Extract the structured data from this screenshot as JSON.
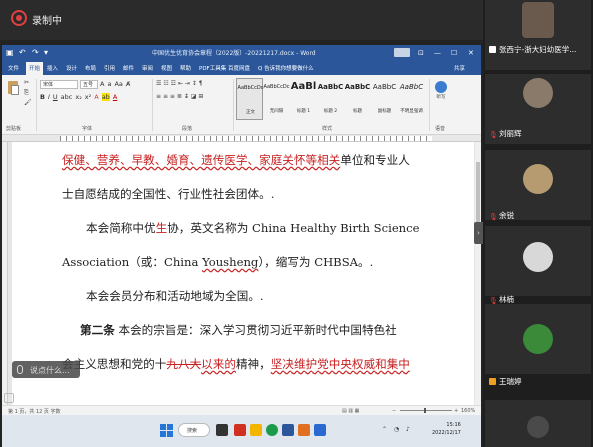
{
  "meeting": {
    "recording_label": "录制中",
    "mic_label": "说点什么..."
  },
  "word": {
    "title": "中国优生优育协会章程（2022版）-20221217.docx - Word",
    "menu": [
      "文件",
      "开始",
      "插入",
      "设计",
      "布局",
      "引用",
      "邮件",
      "审阅",
      "视图",
      "帮助",
      "PDF工具集",
      "百度网盘",
      "Q 告诉我你想要做什么"
    ],
    "menu_right": "共享",
    "font_name": "宋体",
    "font_size": "五号",
    "styles": [
      {
        "sample": "AaBbCcDc",
        "name": "正文"
      },
      {
        "sample": "AaBbCcDc",
        "name": "无间隔"
      },
      {
        "sample": "AaBl",
        "name": "标题 1"
      },
      {
        "sample": "AaBbC",
        "name": "标题 2"
      },
      {
        "sample": "AaBbC",
        "name": "标题"
      },
      {
        "sample": "AaBbC",
        "name": "副标题"
      },
      {
        "sample": "AaBbC",
        "name": "不明显强调"
      }
    ],
    "dictate_label": "听写",
    "ribbon_groups": [
      "剪贴板",
      "字体",
      "段落",
      "样式",
      "语音"
    ],
    "doc_lines": {
      "l1_red": "保健、营养、早教、婚育、遗传医学、家庭关怀等相关",
      "l1_black": "单位和专业人",
      "l2": "士自愿结成的全国性、行业性社会团体。.",
      "l3_pre": "本会简称中优",
      "l3_red": "生",
      "l3_post": "协，英文名称为 China Healthy Birth Science",
      "l4_pre": "Association（或：China ",
      "l4_red": "Yousheng",
      "l4_post": "），缩写为 CHBSA。.",
      "l5": "本会会员分布和活动地域为全国。.",
      "l6_bold": "第二条",
      "l6_rest": " 本会的宗旨是：深入学习贯彻习近平新时代中国特色社",
      "l7_pre": "会主义思想和党的十",
      "l7_red1": "九八大",
      "l7_red2": "以来的",
      "l7_mid": "精神，",
      "l7_red3": "坚决维护党中央权威和集中"
    },
    "status_left": "第 1 页，共 12 页    字数",
    "zoom_label": "160%"
  },
  "taskbar": {
    "search_label": "搜索",
    "time": "15:16",
    "date": "2022/12/17"
  },
  "participants": [
    {
      "name": "张西宁-浙大妇幼医学...",
      "muted": false
    },
    {
      "name": "刘丽辉",
      "muted": true
    },
    {
      "name": "余锐",
      "muted": true
    },
    {
      "name": "林楠",
      "muted": true
    },
    {
      "name": "王瑞婷",
      "muted": true
    }
  ],
  "colors": {
    "word_blue": "#2b579a",
    "red_text": "#c82020",
    "panel_bg": "#1e1e1e"
  }
}
